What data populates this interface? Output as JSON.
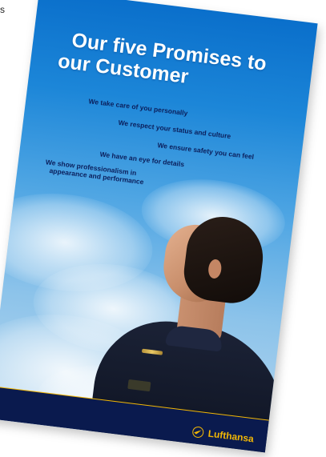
{
  "corner_text": "s",
  "poster": {
    "title_line1": "Our five Promises to",
    "title_line2": "our Customer",
    "promises": [
      "We take care of you personally",
      "We respect your status and culture",
      "We ensure safety you can feel",
      "We have an eye for details"
    ],
    "promise5_line1": "We show professionalism in",
    "promise5_line2": "appearance and performance",
    "brand_name": "Lufthansa",
    "brand_icon": "crane-logo-icon"
  },
  "colors": {
    "sky_top": "#0a6fcb",
    "sky_bottom": "#b9d8ef",
    "promise_text": "#0b1f5c",
    "footer": "#0a1a4e",
    "brand_yellow": "#f2b705"
  }
}
